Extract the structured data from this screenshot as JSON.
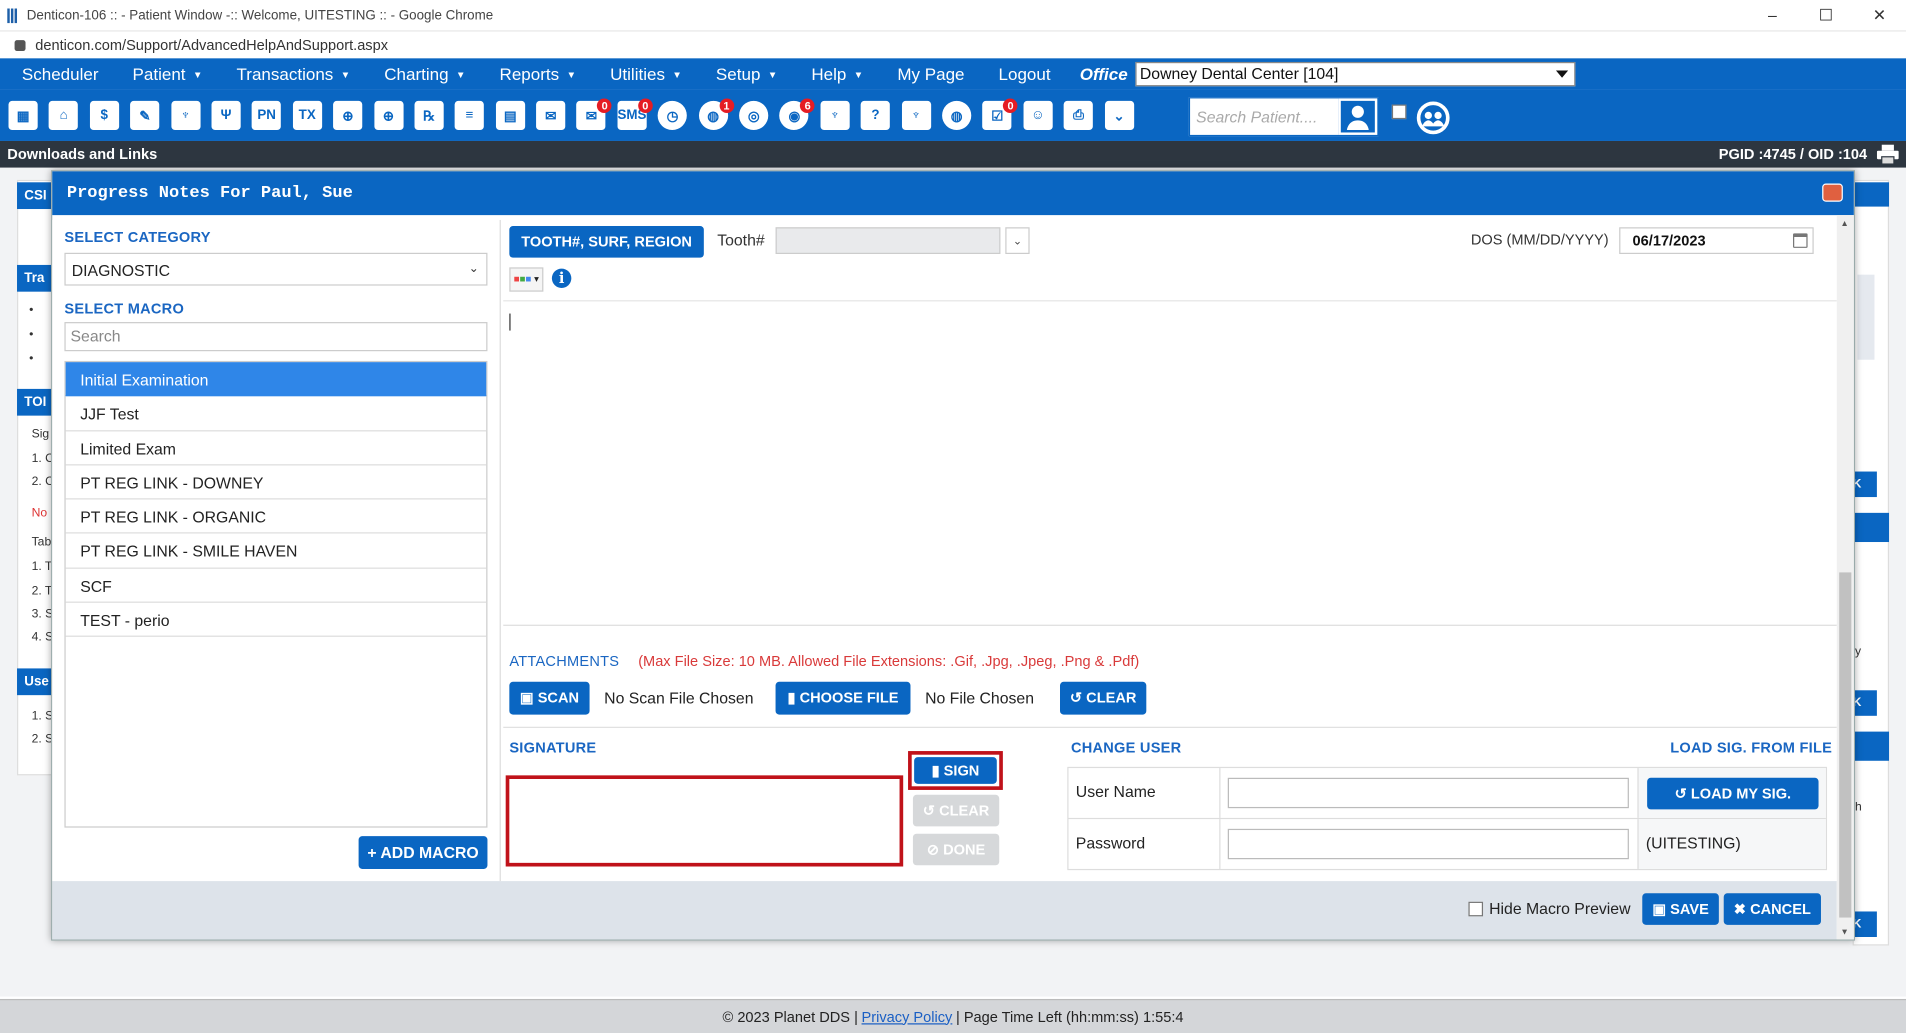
{
  "window": {
    "title": "Denticon-106 :: - Patient Window -:: Welcome, UITESTING :: - Google Chrome",
    "url": "denticon.com/Support/AdvancedHelpAndSupport.aspx",
    "controls": [
      "–",
      "☐",
      "✕"
    ]
  },
  "menu": {
    "items": [
      {
        "label": "Scheduler",
        "caret": ""
      },
      {
        "label": "Patient",
        "caret": "▼"
      },
      {
        "label": "Transactions",
        "caret": "▼"
      },
      {
        "label": "Charting",
        "caret": "▼"
      },
      {
        "label": "Reports",
        "caret": "▼"
      },
      {
        "label": "Utilities",
        "caret": "▼"
      },
      {
        "label": "Setup",
        "caret": "▼"
      },
      {
        "label": "Help",
        "caret": "▼"
      },
      {
        "label": "My Page",
        "caret": ""
      },
      {
        "label": "Logout",
        "caret": ""
      }
    ],
    "office_label": "Office",
    "office_value": "Downey Dental Center [104]"
  },
  "toolbar": {
    "icons": [
      {
        "name": "calendar-icon",
        "glyph": "▦",
        "badge": ""
      },
      {
        "name": "home-icon",
        "glyph": "⌂",
        "badge": ""
      },
      {
        "name": "dollar-icon",
        "glyph": "$",
        "badge": ""
      },
      {
        "name": "edit-icon",
        "glyph": "✎",
        "badge": ""
      },
      {
        "name": "tooth-icon",
        "glyph": "♆",
        "badge": ""
      },
      {
        "name": "tooth-roots-icon",
        "glyph": "Ψ",
        "badge": ""
      },
      {
        "name": "pn-icon",
        "glyph": "PN",
        "badge": ""
      },
      {
        "name": "tx-icon",
        "glyph": "TX",
        "badge": ""
      },
      {
        "name": "add-patient-icon",
        "glyph": "⊕",
        "badge": ""
      },
      {
        "name": "add-family-icon",
        "glyph": "⊕",
        "badge": ""
      },
      {
        "name": "rx-icon",
        "glyph": "℞",
        "badge": ""
      },
      {
        "name": "note-icon",
        "glyph": "≡",
        "badge": ""
      },
      {
        "name": "document-icon",
        "glyph": "▤",
        "badge": ""
      },
      {
        "name": "mail-icon",
        "glyph": "✉",
        "badge": ""
      },
      {
        "name": "message-icon",
        "glyph": "✉",
        "badge": "0"
      },
      {
        "name": "sms-icon",
        "glyph": "SMS",
        "badge": "0"
      },
      {
        "name": "clock-icon",
        "glyph": "◷",
        "badge": ""
      },
      {
        "name": "globe-icon",
        "glyph": "◍",
        "badge": "1"
      },
      {
        "name": "support-icon",
        "glyph": "◎",
        "badge": ""
      },
      {
        "name": "user-alert-icon",
        "glyph": "◉",
        "badge": "6"
      },
      {
        "name": "molar-icon",
        "glyph": "♆",
        "badge": ""
      },
      {
        "name": "tooth-help-icon",
        "glyph": "?",
        "badge": ""
      },
      {
        "name": "tooth-chart-icon",
        "glyph": "♆",
        "badge": ""
      },
      {
        "name": "world-search-icon",
        "glyph": "◍",
        "badge": ""
      },
      {
        "name": "task-icon",
        "glyph": "☑",
        "badge": "0"
      },
      {
        "name": "group-icon",
        "glyph": "☺",
        "badge": ""
      },
      {
        "name": "printer-icon",
        "glyph": "⎙",
        "badge": ""
      },
      {
        "name": "chevrons-down-icon",
        "glyph": "⌄",
        "badge": ""
      }
    ],
    "search_placeholder": "Search Patient...."
  },
  "strip": {
    "left": "Downloads and Links",
    "right": "PGID :4745  /  OID :104"
  },
  "background": {
    "fragments": [
      "CSI",
      "Tra",
      "TOI",
      "Sig",
      "1. C",
      "2. C",
      "No",
      "Tab",
      "1. T",
      "2. T",
      "3. S",
      "4. S",
      "Use",
      "1. S",
      "2. S",
      "K",
      "K",
      "K",
      "y",
      "h",
      "•",
      "•",
      "•"
    ]
  },
  "modal": {
    "title": "Progress Notes For Paul, Sue",
    "select_category_label": "SELECT CATEGORY",
    "category_value": "DIAGNOSTIC",
    "select_macro_label": "SELECT MACRO",
    "macro_search_placeholder": "Search",
    "macros": [
      "Initial Examination",
      "JJF Test",
      "Limited Exam",
      "PT REG LINK - DOWNEY",
      "PT REG LINK - ORGANIC",
      "PT REG LINK - SMILE HAVEN",
      "SCF",
      "TEST - perio"
    ],
    "selected_macro_index": 0,
    "add_macro_label": "+ ADD MACRO",
    "tooth_button": "TOOTH#, SURF, REGION",
    "tooth_label": "Tooth#",
    "tooth_value": "",
    "dos_label": "DOS (MM/DD/YYYY)",
    "dos_value": "06/17/2023",
    "note_text": "",
    "attachments_label": "ATTACHMENTS",
    "attachments_info": "(Max File Size: 10 MB. Allowed File Extensions: .Gif, .Jpg, .Jpeg, .Png & .Pdf)",
    "scan_button": "SCAN",
    "no_scan_text": "No Scan File Chosen",
    "choose_file_button": "CHOOSE FILE",
    "no_file_text": "No File Chosen",
    "clear_attach_button": "CLEAR",
    "signature_label": "SIGNATURE",
    "sign_button": "SIGN",
    "sig_clear_button": "CLEAR",
    "sig_done_button": "DONE",
    "change_user_label": "CHANGE USER",
    "load_sig_from_file_label": "LOAD SIG. FROM FILE",
    "username_label": "User Name",
    "username_value": "",
    "password_label": "Password",
    "password_value": "",
    "load_my_sig_button": "LOAD MY SIG.",
    "current_user": "(UITESTING)",
    "hide_macro_preview_label": "Hide Macro Preview",
    "save_button": "SAVE",
    "cancel_button": "CANCEL"
  },
  "footer": {
    "copyright": "© 2023 Planet DDS |",
    "privacy_link": "Privacy Policy",
    "page_time": "| Page Time Left (hh:mm:ss) 1:55:4"
  },
  "colors": {
    "brand_blue": "#0a66c2",
    "highlight_red": "#c0121a",
    "attachment_info_red": "#d93a3a",
    "selected_macro": "#2f86e8"
  }
}
